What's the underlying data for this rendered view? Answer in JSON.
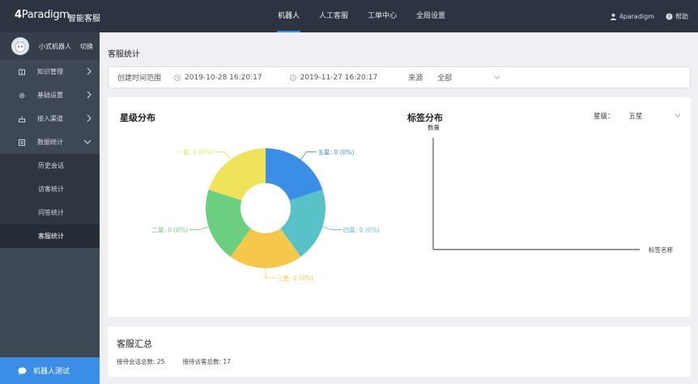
{
  "header": {
    "logo_digit": "4",
    "logo_word": "Paradigm",
    "brand_title": "智能客服",
    "nav": [
      {
        "label": "机器人",
        "active": true
      },
      {
        "label": "人工客服",
        "active": false
      },
      {
        "label": "工单中心",
        "active": false
      },
      {
        "label": "全局设置",
        "active": false
      }
    ],
    "user": "4paradigm",
    "help": "帮助"
  },
  "sidebar": {
    "robot_name": "小式机器人",
    "switch_label": "切换",
    "menu": [
      {
        "label": "知识管理",
        "icon": "book-icon",
        "chevron": "right"
      },
      {
        "label": "基础设置",
        "icon": "gear-icon",
        "chevron": "right"
      },
      {
        "label": "接入渠道",
        "icon": "channel-icon",
        "chevron": "right"
      },
      {
        "label": "数据统计",
        "icon": "stats-icon",
        "chevron": "down"
      }
    ],
    "submenu": [
      {
        "label": "历史会话",
        "active": false
      },
      {
        "label": "访客统计",
        "active": false
      },
      {
        "label": "问答统计",
        "active": false
      },
      {
        "label": "客服统计",
        "active": true
      }
    ],
    "robot_test": "机器人测试"
  },
  "page": {
    "title": "客服统计",
    "filter": {
      "range_label": "创建时间范围",
      "start": "2019-10-28 16:20:17",
      "end": "2019-11-27 16:20:17",
      "source_label": "来源",
      "source_value": "全部"
    }
  },
  "rating_chart": {
    "title": "星级分布",
    "labels": [
      "五星: 0 (0%)",
      "四星: 0 (0%)",
      "三星: 0 (0%)",
      "二星: 0 (0%)",
      "一星: 0 (0%)"
    ],
    "colors": [
      "#3a8ee6",
      "#58c2c8",
      "#f5c74a",
      "#6ccf7f",
      "#eee35a"
    ]
  },
  "tag_chart": {
    "title": "标签分布",
    "rating_label": "星级：",
    "rating_value": "五星",
    "ylabel": "数量",
    "xlabel": "标签名称"
  },
  "chart_data": [
    {
      "type": "pie",
      "title": "星级分布",
      "categories": [
        "五星",
        "四星",
        "三星",
        "二星",
        "一星"
      ],
      "values": [
        0,
        0,
        0,
        0,
        0
      ],
      "percent": [
        0,
        0,
        0,
        0,
        0
      ]
    },
    {
      "type": "bar",
      "title": "标签分布",
      "categories": [],
      "values": [],
      "xlabel": "标签名称",
      "ylabel": "数量"
    }
  ],
  "summary": {
    "title": "客服汇总",
    "sessions_label": "接待会话总数: 25",
    "visitors_label": "接待访客总数: 17"
  }
}
